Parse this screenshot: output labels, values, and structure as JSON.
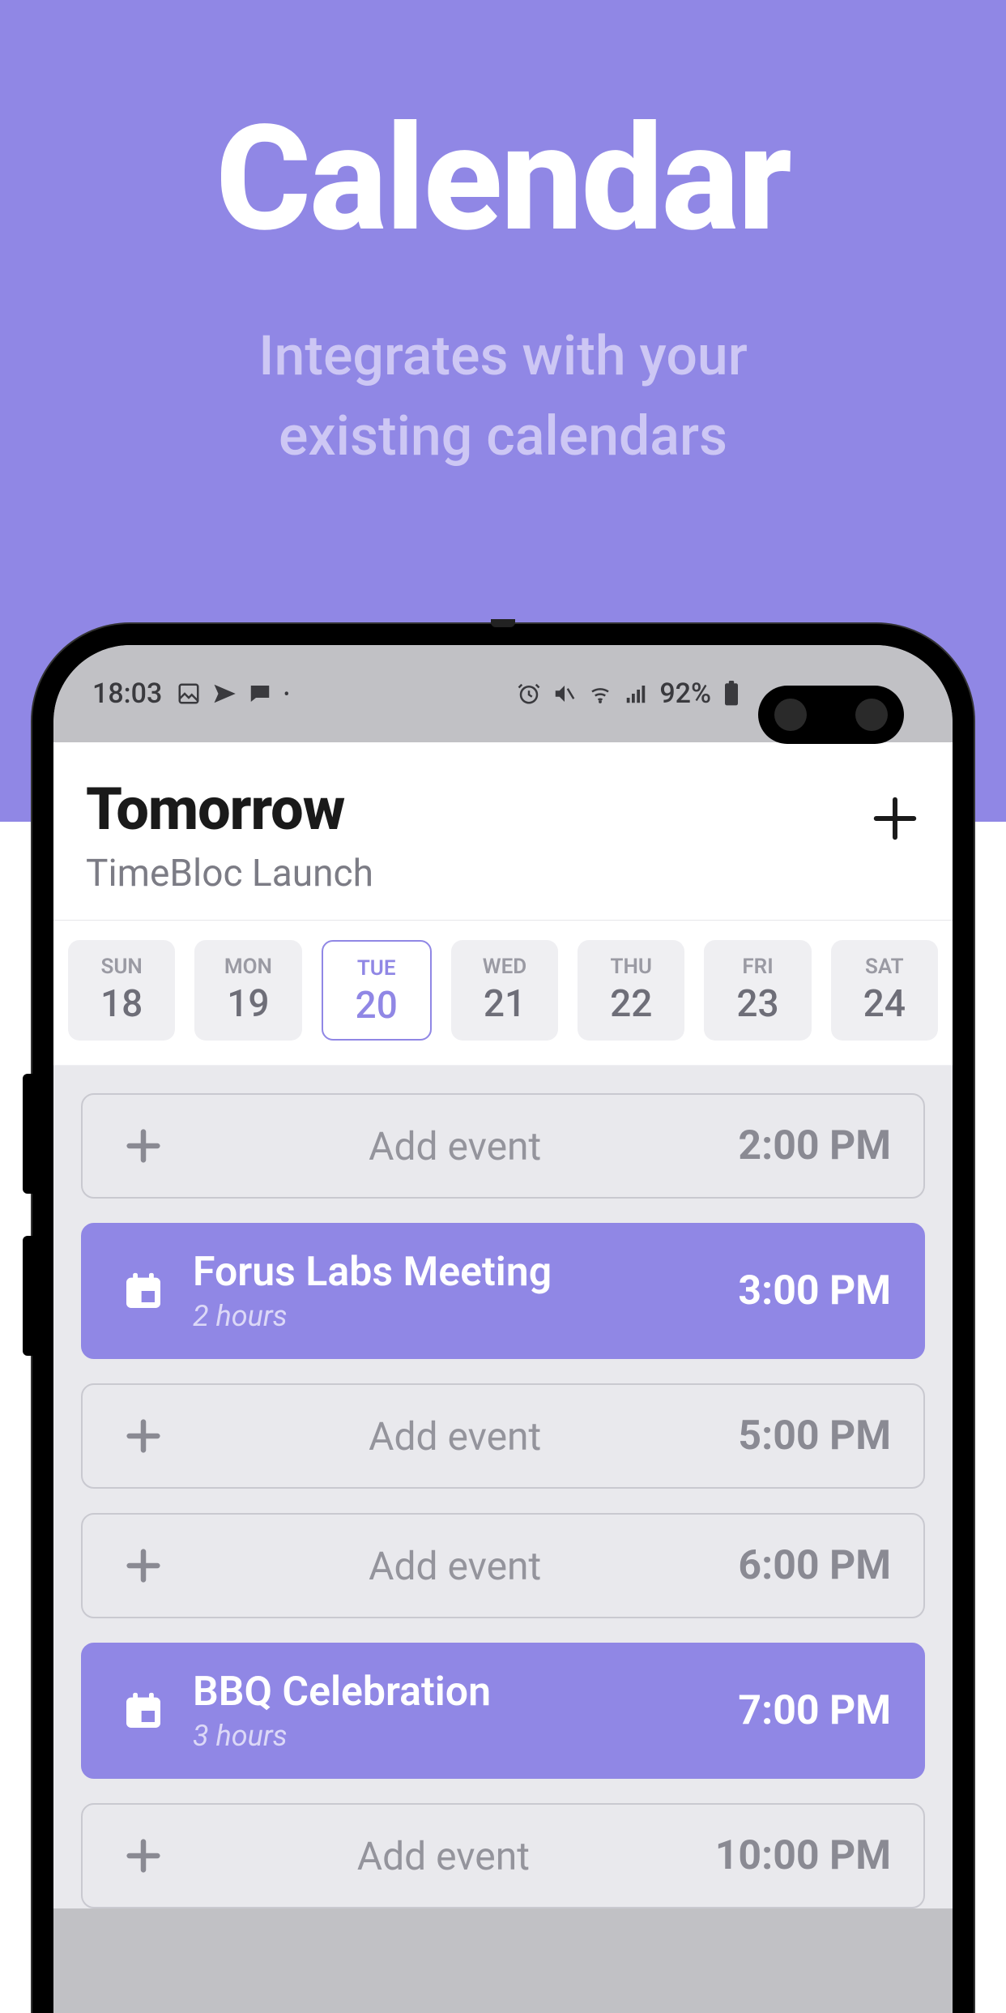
{
  "marketing": {
    "title": "Calendar",
    "subtitle_l1": "Integrates with your",
    "subtitle_l2": "existing calendars"
  },
  "status_bar": {
    "time": "18:03",
    "battery_percent": "92%"
  },
  "header": {
    "title": "Tomorrow",
    "subtitle": "TimeBloc Launch"
  },
  "week": [
    {
      "dow": "SUN",
      "dom": "18",
      "selected": false
    },
    {
      "dow": "MON",
      "dom": "19",
      "selected": false
    },
    {
      "dow": "TUE",
      "dom": "20",
      "selected": true
    },
    {
      "dow": "WED",
      "dom": "21",
      "selected": false
    },
    {
      "dow": "THU",
      "dom": "22",
      "selected": false
    },
    {
      "dow": "FRI",
      "dom": "23",
      "selected": false
    },
    {
      "dow": "SAT",
      "dom": "24",
      "selected": false
    }
  ],
  "rows": [
    {
      "type": "add",
      "label": "Add event",
      "time": "2:00 PM"
    },
    {
      "type": "event",
      "title": "Forus Labs Meeting",
      "duration": "2 hours",
      "time": "3:00 PM"
    },
    {
      "type": "add",
      "label": "Add event",
      "time": "5:00 PM"
    },
    {
      "type": "add",
      "label": "Add event",
      "time": "6:00 PM"
    },
    {
      "type": "event",
      "title": "BBQ Celebration",
      "duration": "3 hours",
      "time": "7:00 PM"
    },
    {
      "type": "add",
      "label": "Add event",
      "time": "10:00 PM"
    }
  ]
}
